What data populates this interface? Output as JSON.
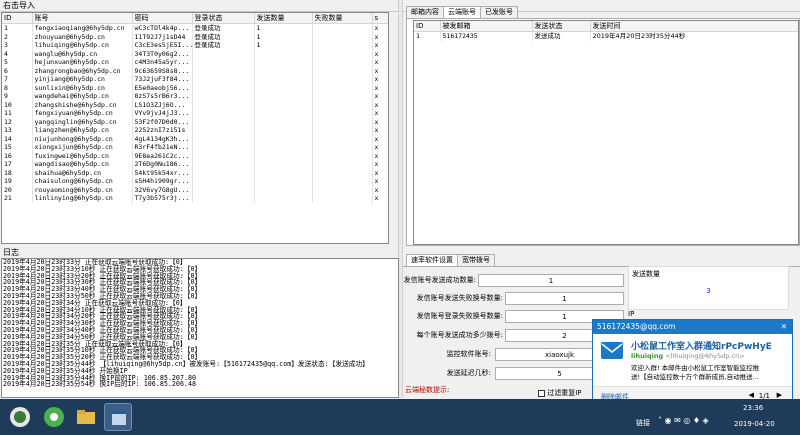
{
  "top_label": "右击导入",
  "accounts": {
    "headers": [
      "ID",
      "账号",
      "密码",
      "登录状态",
      "发送数量",
      "失败数量",
      "s"
    ],
    "rows": [
      [
        "1",
        "fengxiaoqiang@6hy5dp.cn",
        "wC3cTDl4k4p...",
        "登录成功",
        "1",
        "",
        "x"
      ],
      [
        "2",
        "zhouyuan@6hy5dp.cn",
        "11T92J7j1sD44",
        "登录成功",
        "1",
        "",
        "x"
      ],
      [
        "3",
        "lihuiqing@6hy5dp.cn",
        "C3cE3es5jE5I...",
        "登录成功",
        "1",
        "",
        "x"
      ],
      [
        "4",
        "wanglu@6hy5dp.cn",
        "34T3T0y06g2...",
        "",
        "",
        "",
        "x"
      ],
      [
        "5",
        "hejunxuan@6hy5dp.cn",
        "c4M3n45a5yr...",
        "",
        "",
        "",
        "x"
      ],
      [
        "6",
        "zhangrongbao@6hy5dp.cn",
        "9c63659S8s8...",
        "",
        "",
        "",
        "x"
      ],
      [
        "7",
        "yinjiang@6hy5dp.cn",
        "73J2juF3f84...",
        "",
        "",
        "",
        "x"
      ],
      [
        "8",
        "sunlixin@6hy5dp.cn",
        "E5e0aeobj56...",
        "",
        "",
        "",
        "x"
      ],
      [
        "9",
        "wangdehai@6hy5dp.cn",
        "8zS7s5rB6r3...",
        "",
        "",
        "",
        "x"
      ],
      [
        "10",
        "zhangshishe@6hy5dp.cn",
        "LS1O3ZJj6O...",
        "",
        "",
        "",
        "x"
      ],
      [
        "11",
        "fengxiyuan@6hy5dp.cn",
        "VYv9jvJ4jJ3...",
        "",
        "",
        "",
        "x"
      ],
      [
        "12",
        "yangqinglin@6hy5dp.cn",
        "53F2f07D0d0...",
        "",
        "",
        "",
        "x"
      ],
      [
        "13",
        "liangzhen@6hy5dp.cn",
        "2252znI7z151s",
        "",
        "",
        "",
        "x"
      ],
      [
        "14",
        "niujunhong@6hy5dp.cn",
        "4gL4134gK3h...",
        "",
        "",
        "",
        "x"
      ],
      [
        "15",
        "xiongxijun@6hy5dp.cn",
        "R3rF4fb21eN...",
        "",
        "",
        "",
        "x"
      ],
      [
        "16",
        "fuxingwei@6hy5dp.cn",
        "9E8ea261C2c...",
        "",
        "",
        "",
        "x"
      ],
      [
        "17",
        "wangdisao@6hy5dp.cn",
        "2T6Dg0Nu186...",
        "",
        "",
        "",
        "x"
      ],
      [
        "18",
        "shaihua@6hy5dp.cn",
        "54kt95k54xr...",
        "",
        "",
        "",
        "x"
      ],
      [
        "19",
        "chaisulong@6hy5dp.cn",
        "s5H4hi909gr...",
        "",
        "",
        "",
        "x"
      ],
      [
        "20",
        "rouyaoming@6hy5dp.cn",
        "32V6vy7G8gU...",
        "",
        "",
        "",
        "x"
      ],
      [
        "21",
        "linlinying@6hy5dp.cn",
        "T7y3b575r3j...",
        "",
        "",
        "",
        "x"
      ]
    ]
  },
  "mail_tabs": [
    "邮箱内容",
    "云端账号",
    "已发账号"
  ],
  "mail": {
    "headers": [
      "ID",
      "被发邮箱",
      "发送状态",
      "发送时间"
    ],
    "rows": [
      [
        "1",
        "516172435",
        "发送成功",
        "2019年4月20日23时35分44秒"
      ]
    ]
  },
  "log": {
    "title": "日志",
    "lines": [
      "2019年4月20日23时33分 正在获取云端账号获取成功:【0】",
      "2019年4月20日23时33分10秒 正在获取云端账号获取成功:【0】",
      "2019年4月20日23时33分20秒 正在获取云端账号获取成功:【0】",
      "2019年4月20日23时33分30秒 正在获取云端账号获取成功:【0】",
      "2019年4月20日23时33分40秒 正在获取云端账号获取成功:【0】",
      "2019年4月20日23时33分50秒 正在获取云端账号获取成功:【0】",
      "2019年4月20日23时34分 正在获取云端账号获取成功:【0】",
      "2019年4月20日23时34分10秒 正在获取云端账号获取成功:【0】",
      "2019年4月20日23时34分20秒 正在获取云端账号获取成功:【0】",
      "2019年4月20日23时34分30秒 正在获取云端账号获取成功:【0】",
      "2019年4月20日23时34分40秒 正在获取云端账号获取成功:【0】",
      "2019年4月20日23时34分50秒 正在获取云端账号获取成功:【0】",
      "2019年4月20日23时35分 正在获取云端账号获取成功:【0】",
      "2019年4月20日23时35分10秒 正在获取云端账号获取成功:【0】",
      "2019年4月20日23时35分20秒 正在获取云端账号获取成功:【0】",
      "2019年4月20日23时35分44秒 【lihuiqing@6hy5dp.cn】被发账号:【516172435@qq.com】发送状态:【发送成功】",
      "2019年4月20日23时35分44秒 开始换IP",
      "2019年4月20日23时35分44秒 换IP前的IP: 106.85.207.80",
      "2019年4月20日23时35分54秒 换IP后的IP: 106.85.206.48"
    ]
  },
  "settings_tabs": [
    "速率软件设置",
    "宽带拨号"
  ],
  "settings": {
    "send_success_label": "发信账号发送成功数量:",
    "send_success_value": "1",
    "send_fail_label": "发信账号发送失败换号数量:",
    "send_fail_value": "1",
    "login_fail_label": "发信账号登录失败换号数量:",
    "login_fail_value": "1",
    "per_account_label": "每个账号发送成功多少拨号:",
    "per_account_value": "2",
    "monitor_label": "监控软件账号:",
    "monitor_value": "xiaoxujk",
    "interval_label": "发送延迟几秒:",
    "interval_value": "5",
    "cloud_hint": "云端秘数提示:",
    "check_label": "过滤重复IP",
    "send_count_title": "发送数量",
    "send_count_value": "3",
    "ip_label": "IP"
  },
  "notification": {
    "sender": "516172435@qq.com",
    "subject": "小松鼠工作室入群通知rPcPwHyE",
    "from": "lihuiqing",
    "from_addr": "<lihuiqing@6hy5dp.cn>",
    "body1": "欢迎入群! 本邮件由小松鼠工作室智能监控推",
    "body2": "送!【自动监控数十万个群新成员,自动推送...",
    "delete_label": "删除邮件",
    "pager": "1/1"
  },
  "taskbar": {
    "link_label": "链接",
    "time": "23:36",
    "date": "2019-04-20"
  }
}
